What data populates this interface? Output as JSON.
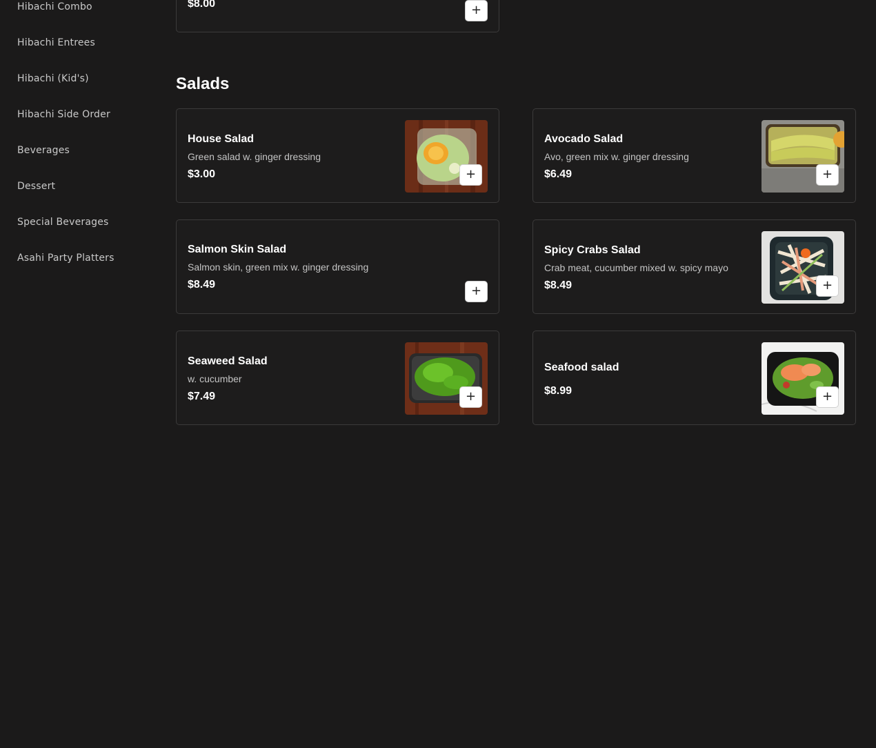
{
  "sidebar": {
    "items": [
      {
        "label": "Hibachi Combo"
      },
      {
        "label": "Hibachi Entrees"
      },
      {
        "label": "Hibachi (Kid's)"
      },
      {
        "label": "Hibachi Side Order"
      },
      {
        "label": "Beverages"
      },
      {
        "label": "Dessert"
      },
      {
        "label": "Special Beverages"
      },
      {
        "label": "Asahi Party Platters"
      }
    ]
  },
  "previous_item": {
    "price": "$8.00",
    "add_label": "+"
  },
  "section": {
    "title": "Salads"
  },
  "items": [
    {
      "name": "House Salad",
      "description": "Green salad w. ginger dressing",
      "price": "$3.00",
      "image": "house-salad-photo",
      "add_label": "+"
    },
    {
      "name": "Avocado Salad",
      "description": "Avo, green mix w. ginger dressing",
      "price": "$6.49",
      "image": "avocado-salad-photo",
      "add_label": "+"
    },
    {
      "name": "Salmon Skin Salad",
      "description": "Salmon skin, green mix w. ginger dressing",
      "price": "$8.49",
      "image": "",
      "add_label": "+"
    },
    {
      "name": "Spicy Crabs Salad",
      "description": "Crab meat, cucumber mixed w. spicy mayo",
      "price": "$8.49",
      "image": "spicy-crabs-salad-photo",
      "add_label": "+"
    },
    {
      "name": "Seaweed Salad",
      "description": "w. cucumber",
      "price": "$7.49",
      "image": "seaweed-salad-photo",
      "add_label": "+"
    },
    {
      "name": "Seafood salad",
      "description": "",
      "price": "$8.99",
      "image": "seafood-salad-photo",
      "add_label": "+"
    }
  ],
  "colors": {
    "background": "#1b1a1a",
    "card_border": "#3c3b3b",
    "sidebar_text": "#c9c9c9",
    "add_button_bg": "#ffffff"
  },
  "icons": {
    "add": "plus-icon"
  }
}
